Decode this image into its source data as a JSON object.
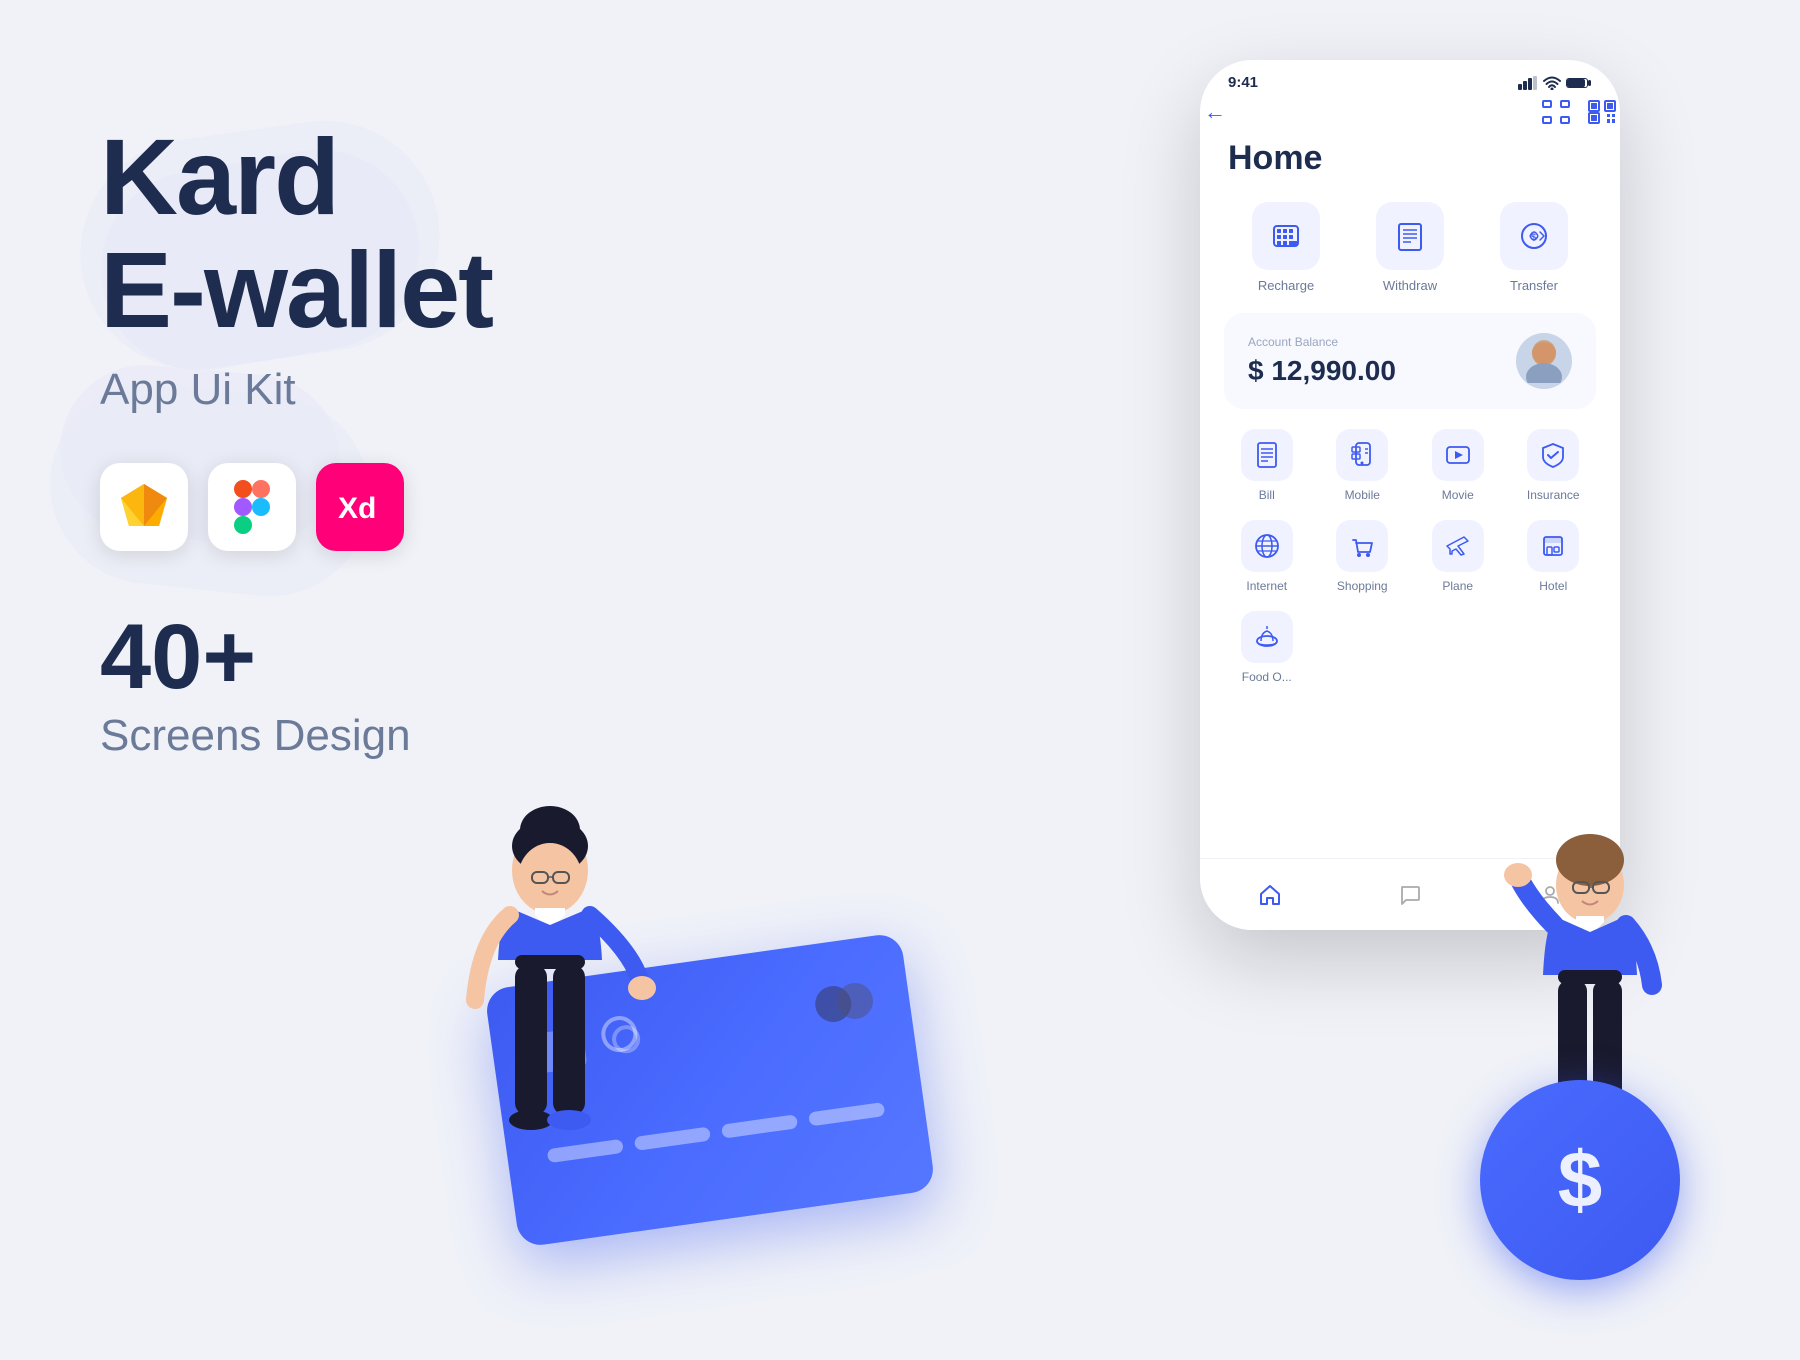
{
  "brand": {
    "line1": "Kard",
    "line2": "E-wallet",
    "subtitle": "App Ui Kit",
    "count": "40+",
    "count_label": "Screens Design"
  },
  "tools": [
    {
      "name": "sketch",
      "label": "Sketch"
    },
    {
      "name": "figma",
      "label": "Figma"
    },
    {
      "name": "xd",
      "label": "Adobe XD"
    }
  ],
  "phone": {
    "status_time": "9:41",
    "screen_title": "Home",
    "balance_label": "Account Balance",
    "balance_amount": "$ 12,990.00",
    "quick_actions": [
      {
        "label": "Recharge"
      },
      {
        "label": "Withdraw"
      },
      {
        "label": "Transfer"
      }
    ],
    "services": [
      {
        "label": "Bill"
      },
      {
        "label": "Mobile"
      },
      {
        "label": "Movie"
      },
      {
        "label": "Insurance"
      },
      {
        "label": "Internet"
      },
      {
        "label": "Shopping"
      },
      {
        "label": "Plane"
      },
      {
        "label": "Hotel"
      },
      {
        "label": "Food O..."
      }
    ]
  }
}
